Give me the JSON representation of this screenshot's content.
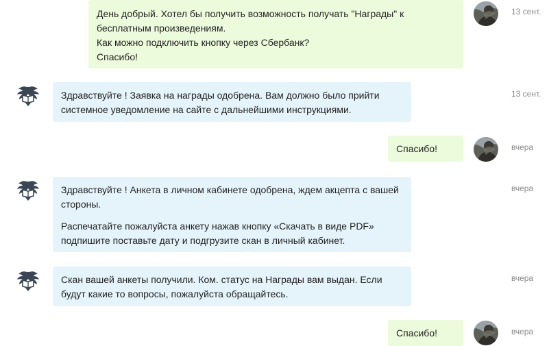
{
  "chat": {
    "messages": [
      {
        "direction": "outgoing",
        "time": "13 сент.",
        "paragraphs": [
          [
            "День добрый. Хотел бы получить возможность получать \"Награды\" к",
            "бесплатным произведениям.",
            "Как можно подключить кнопку через Сбербанк?",
            "Спасибо!"
          ]
        ]
      },
      {
        "direction": "incoming",
        "time": "13 сент.",
        "paragraphs": [
          [
            "Здравствуйте ! Заявка на награды одобрена. Вам должно было прийти",
            "системное уведомление на сайте с дальнейшими инструкциями."
          ]
        ]
      },
      {
        "direction": "outgoing",
        "time": "вчера",
        "paragraphs": [
          [
            "Спасибо!"
          ]
        ]
      },
      {
        "direction": "incoming",
        "time": "вчера",
        "paragraphs": [
          [
            "Здравствуйте ! Анкета в личном кабинете одобрена, ждем акцепта с вашей",
            "стороны."
          ],
          [
            "Распечатайте пожалуйста анкету нажав кнопку «Скачать в виде PDF»",
            "подпишите поставьте дату и подгрузите скан в личный кабинет."
          ]
        ]
      },
      {
        "direction": "incoming",
        "time": "вчера",
        "paragraphs": [
          [
            "Скан вашей анкеты получили. Ком. статус на Награды вам выдан. Если",
            "будут какие то вопросы, пожалуйста обращайтесь."
          ]
        ]
      },
      {
        "direction": "outgoing",
        "time": "вчера",
        "paragraphs": [
          [
            "Спасибо!"
          ]
        ]
      }
    ]
  },
  "colors": {
    "incoming_bubble": "#e5f3fb",
    "outgoing_bubble": "#ecfbdc",
    "timestamp": "#8a8a8a",
    "text": "#222222"
  },
  "icons": {
    "incoming_avatar": "eagle-with-book-logo-icon",
    "outgoing_avatar": "user-photo-avatar"
  }
}
